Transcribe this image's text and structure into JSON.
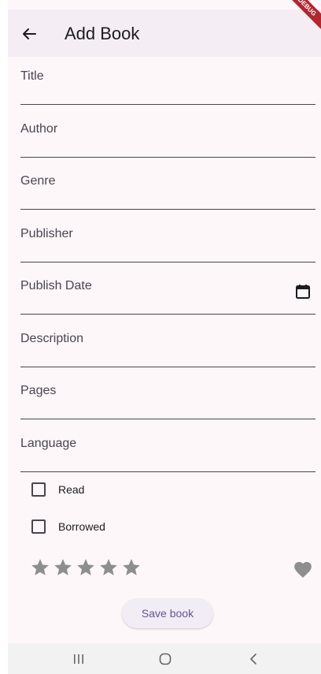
{
  "appbar": {
    "title": "Add Book",
    "debug_label": "DEBUG"
  },
  "fields": [
    {
      "label": "Title"
    },
    {
      "label": "Author"
    },
    {
      "label": "Genre"
    },
    {
      "label": "Publisher"
    },
    {
      "label": "Publish Date",
      "icon": "calendar-icon"
    },
    {
      "label": "Description"
    },
    {
      "label": "Pages"
    },
    {
      "label": "Language"
    }
  ],
  "checkboxes": [
    {
      "label": "Read",
      "checked": false
    },
    {
      "label": "Borrowed",
      "checked": false
    }
  ],
  "rating": {
    "value": 0,
    "max": 5,
    "favorite": false
  },
  "save_button": {
    "label": "Save book"
  },
  "colors": {
    "background": "#fef7fa",
    "appbar": "#f4eef4",
    "accent": "#65558f",
    "icon_gray": "#8e8e8e"
  },
  "navbar": {
    "icons": [
      "recent-apps-icon",
      "home-icon",
      "back-nav-icon"
    ]
  }
}
